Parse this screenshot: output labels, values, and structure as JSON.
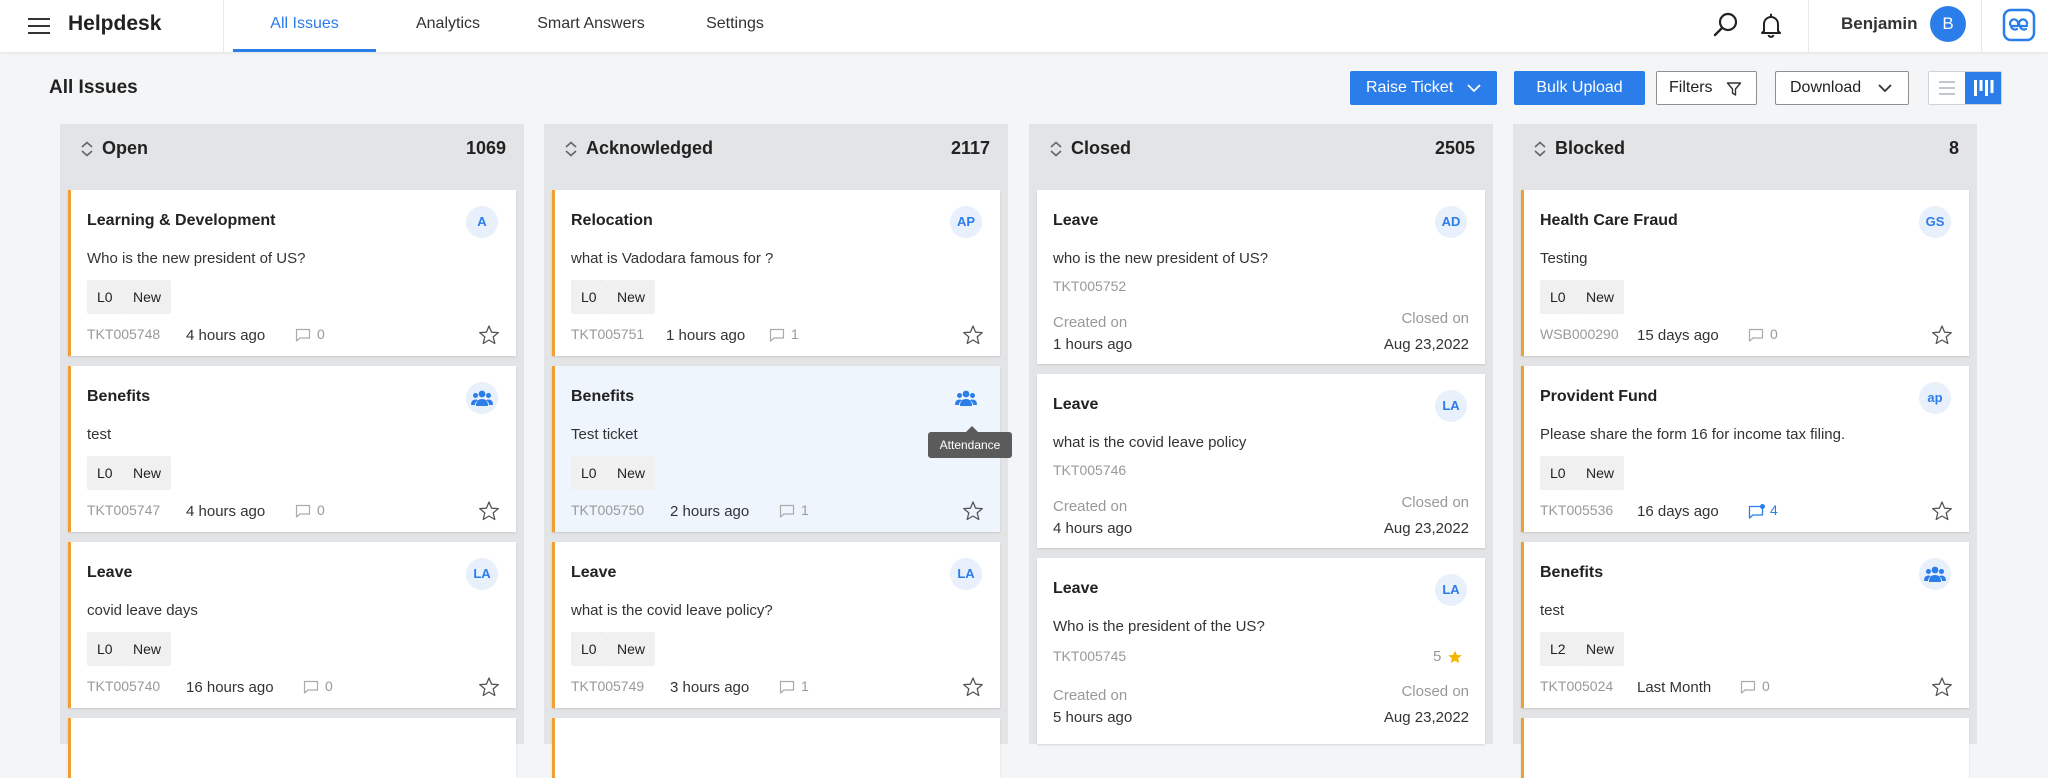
{
  "app": {
    "title": "Helpdesk"
  },
  "nav": {
    "tabs": [
      {
        "label": "All Issues",
        "active": true
      },
      {
        "label": "Analytics"
      },
      {
        "label": "Smart Answers"
      },
      {
        "label": "Settings"
      }
    ]
  },
  "user": {
    "name": "Benjamin",
    "initial": "B"
  },
  "icons": {
    "menu": "hamburger-icon",
    "search": "search-icon",
    "notifications": "bell-icon",
    "brand": "brand-logo-icon",
    "sort": "sort-arrows-icon",
    "comment": "chat-bubble-icon",
    "star": "star-outline-icon",
    "group": "people-group-icon"
  },
  "colors": {
    "primary": "#2b7de9",
    "accent": "#f0a030",
    "star": "#f5b400"
  },
  "page": {
    "title": "All Issues"
  },
  "toolbar": {
    "raise_ticket": "Raise Ticket",
    "bulk_upload": "Bulk Upload",
    "filters": "Filters",
    "download": "Download"
  },
  "tooltip": {
    "text": "Attendance"
  },
  "columns": [
    {
      "title": "Open",
      "count": "1069",
      "cards": [
        {
          "title": "Learning & Development",
          "badge": "A",
          "desc": "Who is the new president of US?",
          "tags": [
            "L0",
            "New"
          ],
          "id": "TKT005748",
          "time": "4 hours ago",
          "comments": "0"
        },
        {
          "title": "Benefits",
          "badge_icon": "people-group-icon",
          "desc": "test",
          "tags": [
            "L0",
            "New"
          ],
          "id": "TKT005747",
          "time": "4 hours ago",
          "comments": "0"
        },
        {
          "title": "Leave",
          "badge": "LA",
          "desc": "covid leave days",
          "tags": [
            "L0",
            "New"
          ],
          "id": "TKT005740",
          "time": "16 hours ago",
          "comments": "0"
        }
      ]
    },
    {
      "title": "Acknowledged",
      "count": "2117",
      "cards": [
        {
          "title": "Relocation",
          "badge": "AP",
          "desc": "what is Vadodara famous for ?",
          "tags": [
            "L0",
            "New"
          ],
          "id": "TKT005751",
          "time": "1 hours ago",
          "comments": "1"
        },
        {
          "title": "Benefits",
          "badge_icon": "people-group-icon",
          "desc": "Test ticket",
          "tags": [
            "L0",
            "New"
          ],
          "id": "TKT005750",
          "time": "2 hours ago",
          "comments": "1"
        },
        {
          "title": "Leave",
          "badge": "LA",
          "desc": "what is the covid leave policy?",
          "tags": [
            "L0",
            "New"
          ],
          "id": "TKT005749",
          "time": "3 hours ago",
          "comments": "1"
        }
      ]
    },
    {
      "title": "Closed",
      "count": "2505",
      "cards": [
        {
          "title": "Leave",
          "badge": "AD",
          "desc": "who is the new president of US?",
          "id": "TKT005752",
          "created_label": "Created on",
          "created": "1 hours ago",
          "closed_label": "Closed on",
          "closed": "Aug 23,2022"
        },
        {
          "title": "Leave",
          "badge": "LA",
          "desc": "what is the covid leave policy",
          "id": "TKT005746",
          "created_label": "Created on",
          "created": "4 hours ago",
          "closed_label": "Closed on",
          "closed": "Aug 23,2022"
        },
        {
          "title": "Leave",
          "badge": "LA",
          "desc": "Who is the president of the US?",
          "id": "TKT005745",
          "rating": "5",
          "created_label": "Created on",
          "created": "5 hours ago",
          "closed_label": "Closed on",
          "closed": "Aug 23,2022"
        }
      ]
    },
    {
      "title": "Blocked",
      "count": "8",
      "cards": [
        {
          "title": "Health Care Fraud",
          "badge": "GS",
          "desc": "Testing",
          "tags": [
            "L0",
            "New"
          ],
          "id": "WSB000290",
          "time": "15 days ago",
          "comments": "0"
        },
        {
          "title": "Provident Fund",
          "badge": "ap",
          "desc": "Please share the form 16 for income tax filing.",
          "tags": [
            "L0",
            "New"
          ],
          "id": "TKT005536",
          "time": "16 days ago",
          "comments": "4"
        },
        {
          "title": "Benefits",
          "badge_icon": "people-group-icon",
          "desc": "test",
          "tags": [
            "L2",
            "New"
          ],
          "id": "TKT005024",
          "time": "Last Month",
          "comments": "0"
        }
      ]
    }
  ]
}
